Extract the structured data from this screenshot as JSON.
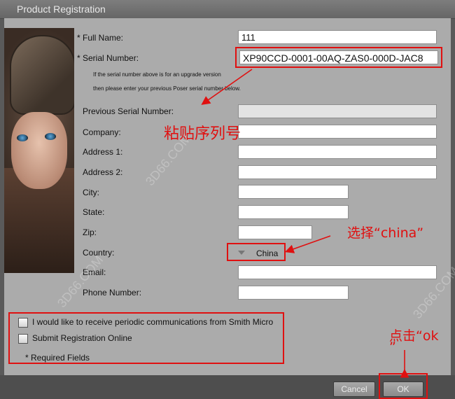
{
  "window": {
    "title": "Product Registration"
  },
  "form": {
    "full_name_label": "* Full Name:",
    "full_name_value": "111",
    "serial_label": "* Serial Number:",
    "serial_value": "XP90CCD-0001-00AQ-ZAS0-000D-JAC8",
    "upgrade_note_line1": "If the serial number above is for an upgrade version",
    "upgrade_note_line2": "then please enter your previous Poser serial number below.",
    "previous_serial_label": "Previous Serial Number:",
    "company_label": "Company:",
    "address1_label": "Address 1:",
    "address2_label": "Address 2:",
    "city_label": "City:",
    "state_label": "State:",
    "zip_label": "Zip:",
    "country_label": "Country:",
    "country_value": "China",
    "email_label": "Email:",
    "phone_label": "Phone Number:"
  },
  "options": {
    "receive_comms_label": "I would like to receive periodic communications from Smith Micro",
    "submit_online_label": "Submit Registration Online",
    "required_note": "* Required Fields"
  },
  "buttons": {
    "cancel": "Cancel",
    "ok": "OK"
  },
  "annotations": {
    "paste_serial": "粘贴序列号",
    "select_china": "选择“china”",
    "click_ok_1": "点击“ok",
    "click_ok_2": "”"
  },
  "watermark": {
    "site": "3D66.COM"
  },
  "colors": {
    "annotation_red": "#e01010",
    "panel_gray": "#ababab"
  }
}
